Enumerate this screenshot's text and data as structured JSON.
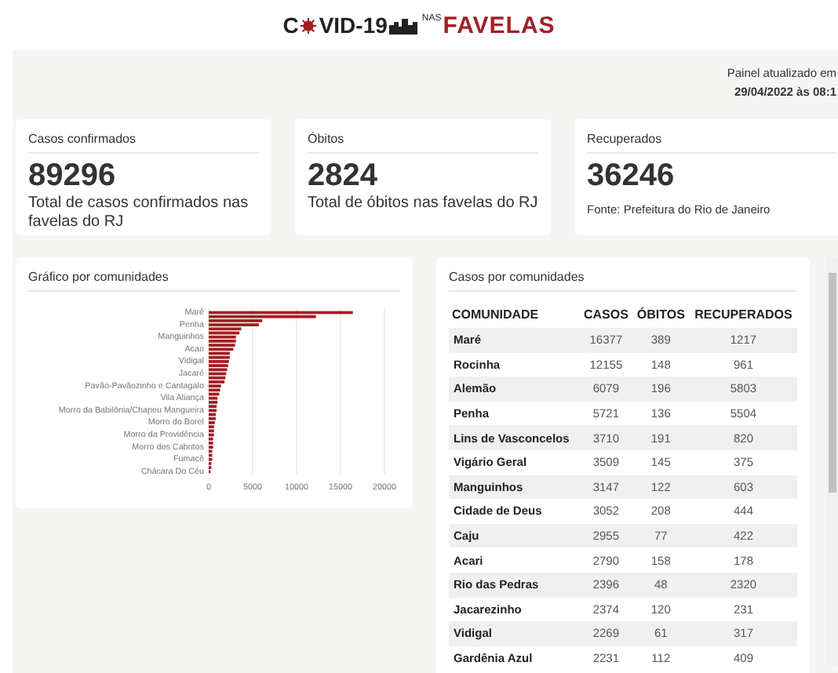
{
  "header": {
    "logo": {
      "part_1": "C",
      "part_2": "VID-19",
      "small": "NAS",
      "accent": "FAVELAS"
    }
  },
  "updated": {
    "label": "Painel atualizado em",
    "timestamp": "29/04/2022 às 08:1"
  },
  "stats": [
    {
      "title": "Casos confirmados",
      "value": "89296",
      "caption": "Total de casos confirmados nas favelas do RJ",
      "kind": "large"
    },
    {
      "title": "Óbitos",
      "value": "2824",
      "caption": "Total de óbitos nas favelas do RJ",
      "kind": "large"
    },
    {
      "title": "Recuperados",
      "value": "36246",
      "caption": "Fonte: Prefeitura do Rio de Janeiro",
      "kind": "small"
    }
  ],
  "chart_card": {
    "title": "Gráfico por comunidades",
    "chart_data": {
      "type": "bar",
      "orientation": "horizontal",
      "categories": [
        "Maré",
        null,
        null,
        "Penha",
        null,
        null,
        "Manguinhos",
        null,
        null,
        "Acari",
        null,
        null,
        "Vidigal",
        null,
        null,
        "Jacaré",
        null,
        null,
        "Pavão-Pavãozinho e Cantagalo",
        null,
        null,
        "Vila Aliança",
        null,
        null,
        "Morro da Babilônia/Chapeu Mangueira",
        null,
        null,
        "Morro do Borel",
        null,
        null,
        "Morro da Providência",
        null,
        null,
        "Morro dos Cabritos",
        null,
        null,
        "Fumacê",
        null,
        null,
        "Chácara Do Céu"
      ],
      "series": [
        {
          "color": "#a31f24",
          "values": [
            16400,
            12200,
            6100,
            5700,
            3700,
            3500,
            3100,
            3100,
            3000,
            2800,
            2400,
            2400,
            2300,
            2200,
            2100,
            2000,
            1900,
            1800,
            1400,
            1300,
            1200,
            1000,
            1000,
            900,
            900,
            800,
            800,
            700,
            600,
            600,
            600,
            500,
            500,
            500,
            400,
            400,
            400,
            300,
            300,
            200
          ]
        }
      ],
      "xlim": [
        0,
        20000
      ],
      "xticks": [
        0,
        5000,
        10000,
        15000,
        20000
      ],
      "grid": true
    }
  },
  "table_card": {
    "title": "Casos por comunidades",
    "columns": [
      "COMUNIDADE",
      "CASOS",
      "ÓBITOS",
      "RECUPERADOS"
    ],
    "rows": [
      [
        "Maré",
        "16377",
        "389",
        "1217"
      ],
      [
        "Rocinha",
        "12155",
        "148",
        "961"
      ],
      [
        "Alemão",
        "6079",
        "196",
        "5803"
      ],
      [
        "Penha",
        "5721",
        "136",
        "5504"
      ],
      [
        "Lins de Vasconcelos",
        "3710",
        "191",
        "820"
      ],
      [
        "Vigário Geral",
        "3509",
        "145",
        "375"
      ],
      [
        "Manguinhos",
        "3147",
        "122",
        "603"
      ],
      [
        "Cidade de Deus",
        "3052",
        "208",
        "444"
      ],
      [
        "Caju",
        "2955",
        "77",
        "422"
      ],
      [
        "Acari",
        "2790",
        "158",
        "178"
      ],
      [
        "Rio das Pedras",
        "2396",
        "48",
        "2320"
      ],
      [
        "Jacarezinho",
        "2374",
        "120",
        "231"
      ],
      [
        "Vidigal",
        "2269",
        "61",
        "317"
      ],
      [
        "Gardênia Azul",
        "2231",
        "112",
        "409"
      ]
    ]
  }
}
